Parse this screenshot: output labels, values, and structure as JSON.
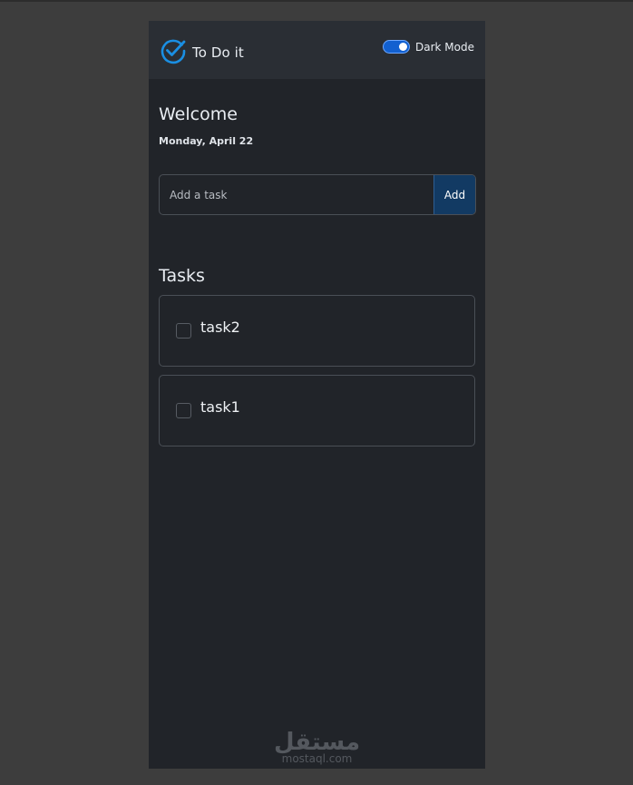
{
  "header": {
    "title": "To Do it",
    "logo_icon": "check-circle-icon",
    "theme_toggle_label": "Dark Mode",
    "theme_toggle_on": true
  },
  "greeting": {
    "title": "Welcome",
    "date": "Monday, April 22"
  },
  "add_task": {
    "placeholder": "Add a task",
    "value": "",
    "button_label": "Add"
  },
  "tasks": {
    "heading": "Tasks",
    "items": [
      {
        "label": "task2",
        "done": false
      },
      {
        "label": "task1",
        "done": false
      }
    ]
  },
  "watermark": {
    "arabic": "مستقل",
    "latin": "mostaql.com"
  },
  "colors": {
    "page_bg": "#3d3d3d",
    "app_bg": "#212429",
    "header_bg": "#2a2e34",
    "accent": "#1a8fe3",
    "add_button_bg": "#123a63"
  }
}
